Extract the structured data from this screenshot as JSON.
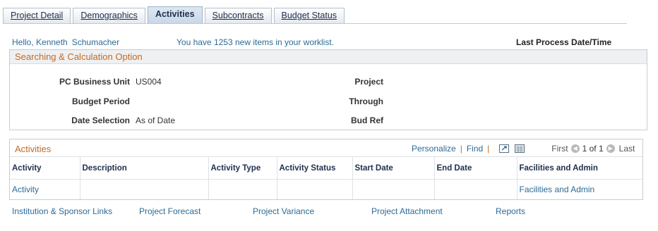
{
  "tabs": [
    {
      "label": "Project Detail"
    },
    {
      "label": "Demographics"
    },
    {
      "label": "Activities"
    },
    {
      "label": "Subcontracts"
    },
    {
      "label": "Budget Status"
    }
  ],
  "header": {
    "greeting_first": "Hello, Kenneth",
    "greeting_last": "Schumacher",
    "worklist": "You have 1253 new items in your worklist.",
    "last_process": "Last Process Date/Time"
  },
  "search": {
    "title": "Searching & Calculation Option",
    "pc_business_unit_label": "PC Business Unit",
    "pc_business_unit_value": "US004",
    "budget_period_label": "Budget Period",
    "date_selection_label": "Date Selection",
    "date_selection_value": "As of Date",
    "project_label": "Project",
    "through_label": "Through",
    "bud_ref_label": "Bud Ref"
  },
  "activities": {
    "title": "Activities",
    "personalize": "Personalize",
    "find": "Find",
    "first": "First",
    "count": "1 of 1",
    "last": "Last",
    "columns": [
      "Activity",
      "Description",
      "Activity Type",
      "Activity Status",
      "Start Date",
      "End Date",
      "Facilities and Admin"
    ],
    "row": [
      "Activity",
      "",
      "",
      "",
      "",
      "",
      "Facilities and Admin"
    ]
  },
  "links": [
    {
      "label": "Institution & Sponsor Links"
    },
    {
      "label": "Project Forecast"
    },
    {
      "label": "Project Variance"
    },
    {
      "label": "Project Attachment"
    },
    {
      "label": "Reports"
    }
  ],
  "colors": {
    "link": "#2c6b94",
    "section_title": "#c46a21",
    "tab_text": "#1f2f4d"
  },
  "icons": [
    "view-all-icon",
    "download-icon",
    "first-arrow-icon",
    "next-arrow-icon"
  ]
}
